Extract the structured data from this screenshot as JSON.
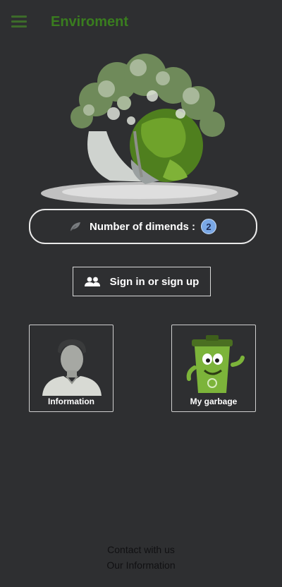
{
  "app_bar": {
    "title": "Enviroment",
    "menu_icon": "hamburger-menu-icon"
  },
  "hero": {
    "image": "earth-globe-with-trees-illustration"
  },
  "counter": {
    "icon": "leaf-icon",
    "label": "Number of dimends :",
    "value": "2"
  },
  "auth": {
    "icon": "people-icon",
    "label": "Sign in or sign up"
  },
  "cards": [
    {
      "label": "Information",
      "image": "person-avatar-illustration"
    },
    {
      "label": "My garbage",
      "image": "garbage-bin-character-illustration"
    }
  ],
  "footer": {
    "contact": "Contact with us",
    "info": "Our Information"
  },
  "colors": {
    "background": "#2e2f31",
    "title_green": "#3a7d1f",
    "badge_blue": "#7aa8e6"
  }
}
